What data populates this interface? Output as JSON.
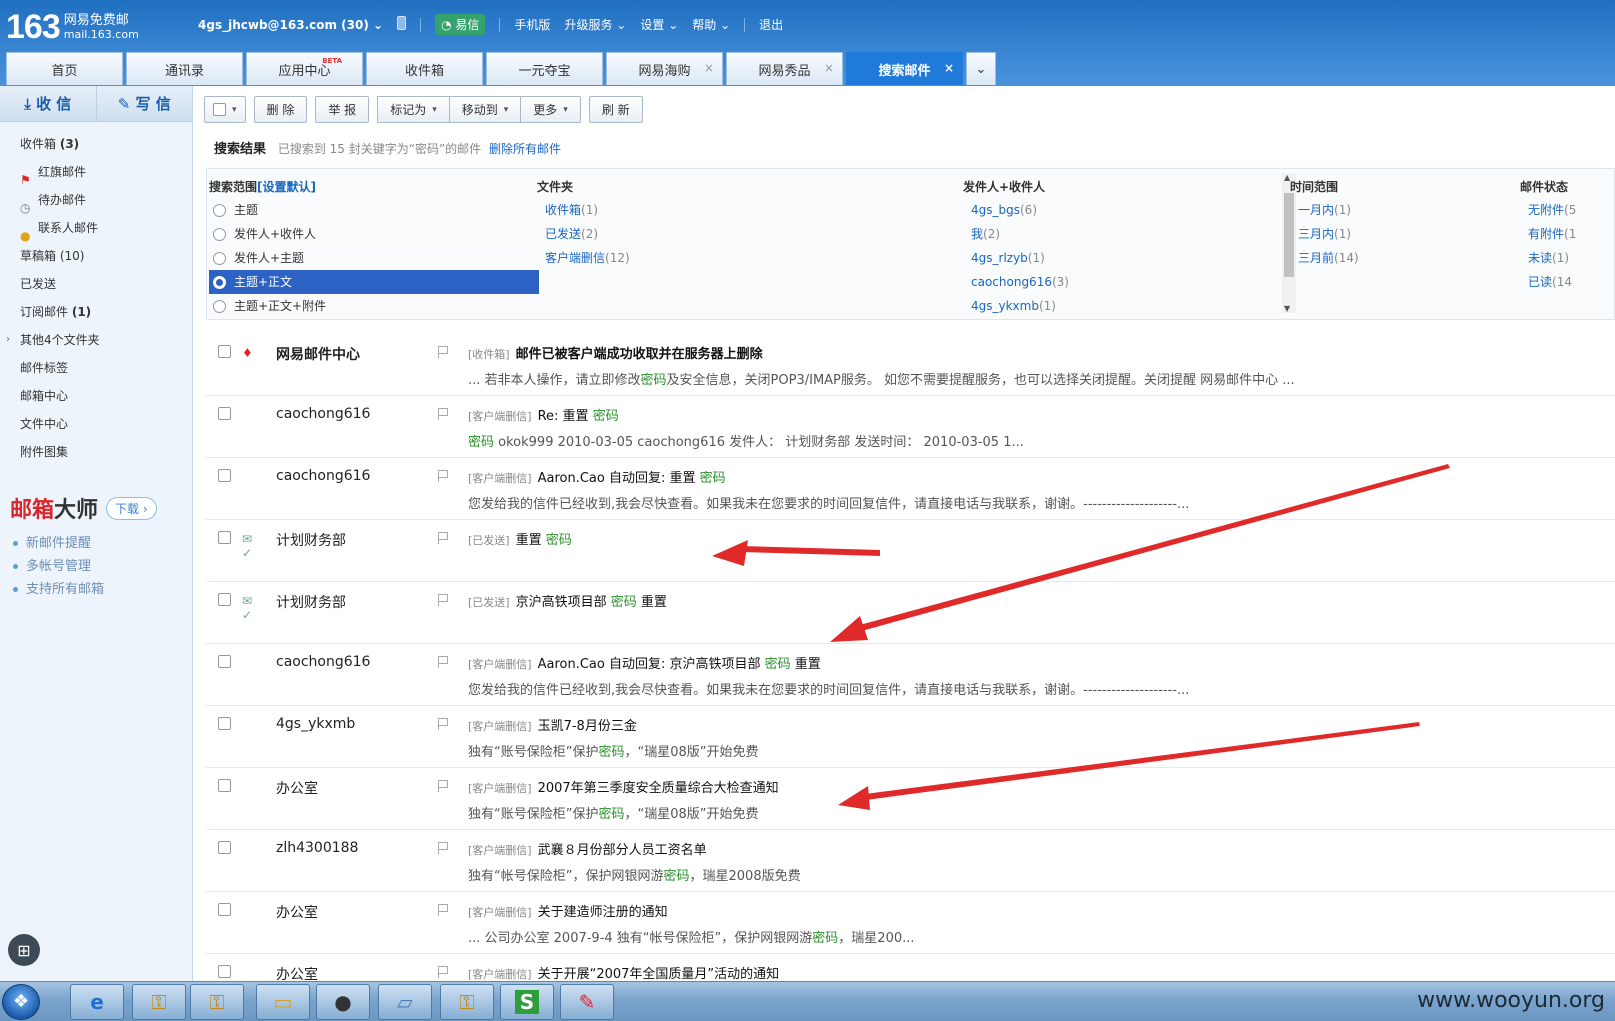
{
  "header": {
    "logo_num": "163",
    "logo_line1": "网易免费邮",
    "logo_line2": "mail.163.com",
    "account": "4gs_jhcwb@163.com (30)",
    "yixin": "易信",
    "links": [
      "手机版",
      "升级服务",
      "设置",
      "帮助",
      "退出"
    ]
  },
  "tabs": [
    {
      "label": "首页"
    },
    {
      "label": "通讯录"
    },
    {
      "label": "应用中心",
      "badge": "BETA"
    },
    {
      "label": "收件箱"
    },
    {
      "label": "一元夺宝"
    },
    {
      "label": "网易海购",
      "close": "×"
    },
    {
      "label": "网易秀品",
      "close": "×"
    },
    {
      "label": "搜索邮件",
      "close": "×",
      "active": true
    }
  ],
  "sidebar": {
    "receive": "收 信",
    "write": "写 信",
    "folders": [
      {
        "label": "收件箱",
        "count": "(3)"
      },
      {
        "label": "红旗邮件"
      },
      {
        "label": "待办邮件"
      },
      {
        "label": "联系人邮件"
      },
      {
        "label": "草稿箱",
        "count": "(10)"
      },
      {
        "label": "已发送"
      },
      {
        "label": "订阅邮件",
        "count": "(1)"
      },
      {
        "label": "其他4个文件夹"
      },
      {
        "label": "邮件标签"
      },
      {
        "label": "邮箱中心"
      },
      {
        "label": "文件中心"
      },
      {
        "label": "附件图集"
      }
    ],
    "promo": {
      "title_red": "邮箱",
      "title_black": "大师",
      "download": "下载",
      "items": [
        "新邮件提醒",
        "多帐号管理",
        "支持所有邮箱"
      ]
    }
  },
  "toolbar": {
    "delete": "删 除",
    "report": "举 报",
    "mark": "标记为",
    "move": "移动到",
    "more": "更多",
    "refresh": "刷 新"
  },
  "result": {
    "title": "搜索结果",
    "desc": "已搜索到 15 封关键字为“密码”的邮件",
    "delete_all": "删除所有邮件"
  },
  "filter": {
    "scope_title": "搜索范围",
    "scope_default": "[设置默认]",
    "scopes": [
      "主题",
      "发件人+收件人",
      "发件人+主题",
      "主题+正文",
      "主题+正文+附件"
    ],
    "folder_title": "文件夹",
    "folders": [
      {
        "name": "收件箱",
        "count": "(1)"
      },
      {
        "name": "已发送",
        "count": "(2)"
      },
      {
        "name": "客户端删信",
        "count": "(12)"
      }
    ],
    "people_title": "发件人+收件人",
    "people": [
      {
        "name": "4gs_bgs",
        "count": "(6)"
      },
      {
        "name": "我",
        "count": "(2)"
      },
      {
        "name": "4gs_rlzyb",
        "count": "(1)"
      },
      {
        "name": "caochong616",
        "count": "(3)"
      },
      {
        "name": "4gs_ykxmb",
        "count": "(1)"
      }
    ],
    "time_title": "时间范围",
    "times": [
      {
        "name": "一月内",
        "count": "(1)"
      },
      {
        "name": "三月内",
        "count": "(1)"
      },
      {
        "name": "三月前",
        "count": "(14)"
      }
    ],
    "status_title": "邮件状态",
    "statuses": [
      {
        "name": "无附件",
        "count": "(5"
      },
      {
        "name": "有附件",
        "count": "(1"
      },
      {
        "name": "未读",
        "count": "(1)"
      },
      {
        "name": "已读",
        "count": "(14"
      }
    ]
  },
  "mails": [
    {
      "sender": "网易邮件中心",
      "folder": "[收件箱]",
      "subject": "邮件已被客户端成功收取并在服务器上删除",
      "snippet_a": "... 若非本人操作，请立即修改",
      "kw": "密码",
      "snippet_b": "及安全信息，关闭POP3/IMAP服务。 如您不需要提醒服务，也可以选择关闭提醒。关闭提醒 网易邮件中心 ..."
    },
    {
      "sender": "caochong616",
      "folder": "[客户端删信]",
      "subject": "Re: 重置",
      "subject_kw": "密码",
      "snippet_a": "",
      "kw": "密码",
      "snippet_b": " okok999 2010-03-05 caochong616 发件人： 计划财务部 发送时间： 2010-03-05 1..."
    },
    {
      "sender": "caochong616",
      "folder": "[客户端删信]",
      "subject": "Aaron.Cao 自动回复: 重置",
      "subject_kw": "密码",
      "snippet_a": "您发给我的信件已经收到,我会尽快查看。如果我未在您要求的时间回复信件，请直接电话与我联系，谢谢。--------------------...",
      "kw": "",
      "snippet_b": ""
    },
    {
      "sender": "计划财务部",
      "folder": "[已发送]",
      "subject": "重置",
      "subject_kw": "密码",
      "snippet_a": "",
      "kw": "",
      "snippet_b": ""
    },
    {
      "sender": "计划财务部",
      "folder": "[已发送]",
      "subject": "京沪高铁项目部",
      "subject_kw": "密码",
      "subject_tail": " 重置",
      "snippet_a": "",
      "kw": "",
      "snippet_b": ""
    },
    {
      "sender": "caochong616",
      "folder": "[客户端删信]",
      "subject": "Aaron.Cao 自动回复: 京沪高铁项目部",
      "subject_kw": "密码",
      "subject_tail": " 重置",
      "snippet_a": "您发给我的信件已经收到,我会尽快查看。如果我未在您要求的时间回复信件，请直接电话与我联系，谢谢。--------------------...",
      "kw": "",
      "snippet_b": ""
    },
    {
      "sender": "4gs_ykxmb",
      "folder": "[客户端删信]",
      "subject": "玉凯7-8月份三金",
      "snippet_a": "独有“账号保险柜”保护",
      "kw": "密码",
      "snippet_b": "，“瑞星08版”开始免费"
    },
    {
      "sender": "办公室",
      "folder": "[客户端删信]",
      "subject": "2007年第三季度安全质量综合大检查通知",
      "snippet_a": "独有“账号保险柜”保护",
      "kw": "密码",
      "snippet_b": "，“瑞星08版”开始免费"
    },
    {
      "sender": "zlh4300188",
      "folder": "[客户端删信]",
      "subject": "武襄８月份部分人员工资名单",
      "snippet_a": "独有“帐号保险柜”，保护网银网游",
      "kw": "密码",
      "snippet_b": "，瑞星2008版免费"
    },
    {
      "sender": "办公室",
      "folder": "[客户端删信]",
      "subject": "关于建造师注册的通知",
      "snippet_a": "... 公司办公室 2007-9-4 独有“帐号保险柜”，保护网银网游",
      "kw": "密码",
      "snippet_b": "，瑞星200..."
    },
    {
      "sender": "办公室",
      "folder": "[客户端删信]",
      "subject": "关于开展“2007年全国质量月”活动的通知",
      "snippet_a": "",
      "kw": "",
      "snippet_b": ""
    }
  ],
  "watermark": "www.wooyun.org",
  "colors": {
    "header_blue": "#1f6fbf",
    "active_tab": "#1f7ad9",
    "keyword_green": "#2a8f2a",
    "arrow_red": "#e02a2a",
    "selected_scope": "#2c62c4"
  }
}
